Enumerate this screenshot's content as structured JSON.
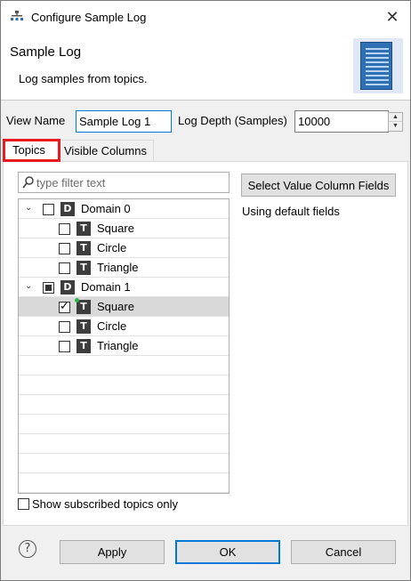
{
  "window": {
    "title": "Configure Sample Log",
    "icon": "sample-log-app-icon"
  },
  "header": {
    "title": "Sample Log",
    "description": "Log samples from topics."
  },
  "form": {
    "view_name_label": "View Name",
    "view_name_value": "Sample Log 1",
    "log_depth_label": "Log Depth (Samples)",
    "log_depth_value": "10000"
  },
  "tabs": [
    {
      "label": "Topics",
      "active": true
    },
    {
      "label": "Visible Columns",
      "active": false
    }
  ],
  "filter": {
    "placeholder": "type filter text"
  },
  "tree": [
    {
      "label": "Domain 0",
      "type": "D",
      "level": 0,
      "expanded": true,
      "check": "unchecked"
    },
    {
      "label": "Square",
      "type": "T",
      "level": 1,
      "check": "unchecked"
    },
    {
      "label": "Circle",
      "type": "T",
      "level": 1,
      "check": "unchecked"
    },
    {
      "label": "Triangle",
      "type": "T",
      "level": 1,
      "check": "unchecked"
    },
    {
      "label": "Domain 1",
      "type": "D",
      "level": 0,
      "expanded": true,
      "check": "partial"
    },
    {
      "label": "Square",
      "type": "T",
      "level": 1,
      "check": "checked",
      "selected": true,
      "active_indicator": true
    },
    {
      "label": "Circle",
      "type": "T",
      "level": 1,
      "check": "unchecked"
    },
    {
      "label": "Triangle",
      "type": "T",
      "level": 1,
      "check": "unchecked"
    }
  ],
  "value_fields": {
    "button_label": "Select Value Column Fields",
    "status": "Using default fields"
  },
  "show_subscribed_label": "Show subscribed topics only",
  "footer": {
    "help": "?",
    "apply": "Apply",
    "ok": "OK",
    "cancel": "Cancel"
  },
  "colors": {
    "accent": "#0078d7",
    "highlight_border": "#e81b23",
    "active_dot": "#2fb34a"
  }
}
